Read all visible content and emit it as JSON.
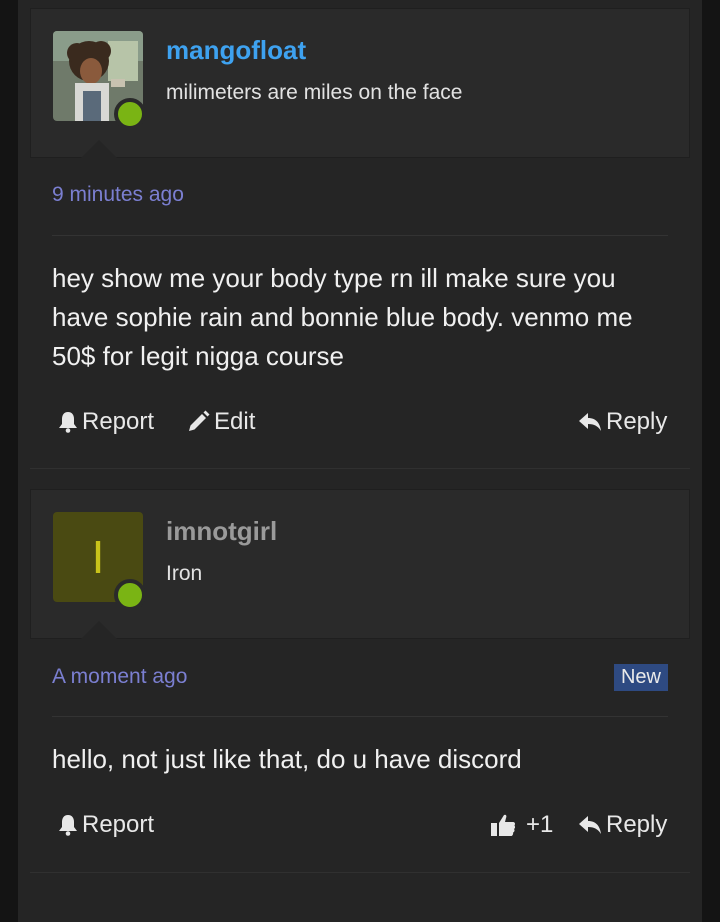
{
  "posts": [
    {
      "username": "mangofloat",
      "username_color": "#3ea2f0",
      "user_title": "milimeters are miles on the face",
      "avatar": "anime-character-avatar",
      "time": "9 minutes ago",
      "message": "hey show me your body type rn ill make sure you have sophie rain and bonnie blue body. venmo me 50$ for legit nigga course",
      "actions": {
        "report": "Report",
        "edit": "Edit",
        "reply": "Reply"
      }
    },
    {
      "username": "imnotgirl",
      "username_color": "#9a9a9a",
      "user_title": "Iron",
      "avatar_letter": "I",
      "time": "A moment ago",
      "badge": "New",
      "message": "hello, not just like that, do u have discord",
      "actions": {
        "report": "Report",
        "like_count": "+1",
        "reply": "Reply"
      }
    }
  ],
  "colors": {
    "background": "#141414",
    "panel": "#252525",
    "online": "#7ab414",
    "time": "#7b7fd1"
  }
}
